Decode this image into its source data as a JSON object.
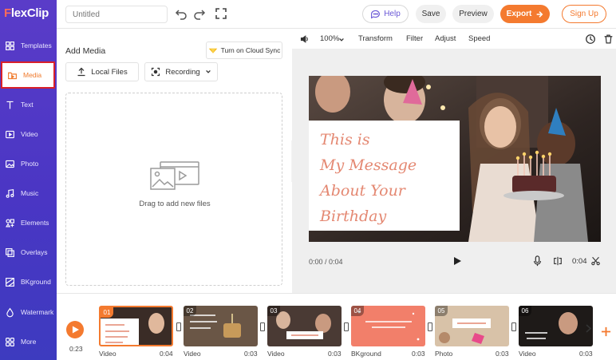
{
  "app": {
    "logo_rest": "lexClip",
    "logo_f": "F"
  },
  "sidebar": {
    "items": [
      {
        "label": "Templates",
        "icon": "templates-icon"
      },
      {
        "label": "Media",
        "icon": "media-folder-icon",
        "active": true
      },
      {
        "label": "Text",
        "icon": "text-icon"
      },
      {
        "label": "Video",
        "icon": "video-icon"
      },
      {
        "label": "Photo",
        "icon": "photo-icon"
      },
      {
        "label": "Music",
        "icon": "music-icon"
      },
      {
        "label": "Elements",
        "icon": "elements-icon"
      },
      {
        "label": "Overlays",
        "icon": "overlays-icon"
      },
      {
        "label": "BKground",
        "icon": "background-icon"
      },
      {
        "label": "Watermark",
        "icon": "watermark-icon"
      },
      {
        "label": "More",
        "icon": "more-icon"
      }
    ]
  },
  "topbar": {
    "title_placeholder": "Untitled",
    "help": "Help",
    "save": "Save",
    "preview": "Preview",
    "export": "Export",
    "signup": "Sign Up"
  },
  "media_panel": {
    "title": "Add Media",
    "cloud_sync": "Turn on Cloud Sync",
    "local_files": "Local Files",
    "recording": "Recording",
    "drop_text": "Drag to add new files"
  },
  "preview_toolbar": {
    "zoom": "100%",
    "transform": "Transform",
    "filter": "Filter",
    "adjust": "Adjust",
    "speed": "Speed"
  },
  "video": {
    "message_lines": [
      "This is",
      "My Message",
      "About Your",
      "Birthday"
    ],
    "time_current": "0:00 / 0:04",
    "time_total": "0:04"
  },
  "timeline": {
    "current_time": "0:23",
    "clips": [
      {
        "num": "01",
        "type": "Video",
        "dur": "0:04",
        "selected": true
      },
      {
        "num": "02",
        "type": "Video",
        "dur": "0:03"
      },
      {
        "num": "03",
        "type": "Video",
        "dur": "0:03"
      },
      {
        "num": "04",
        "type": "BKground",
        "dur": "0:03"
      },
      {
        "num": "05",
        "type": "Photo",
        "dur": "0:03"
      },
      {
        "num": "06",
        "type": "Video",
        "dur": "0:03"
      }
    ]
  },
  "colors": {
    "accent": "#f47a2f",
    "sidebar": "#4a36c4",
    "help_text": "#6a58d6"
  }
}
